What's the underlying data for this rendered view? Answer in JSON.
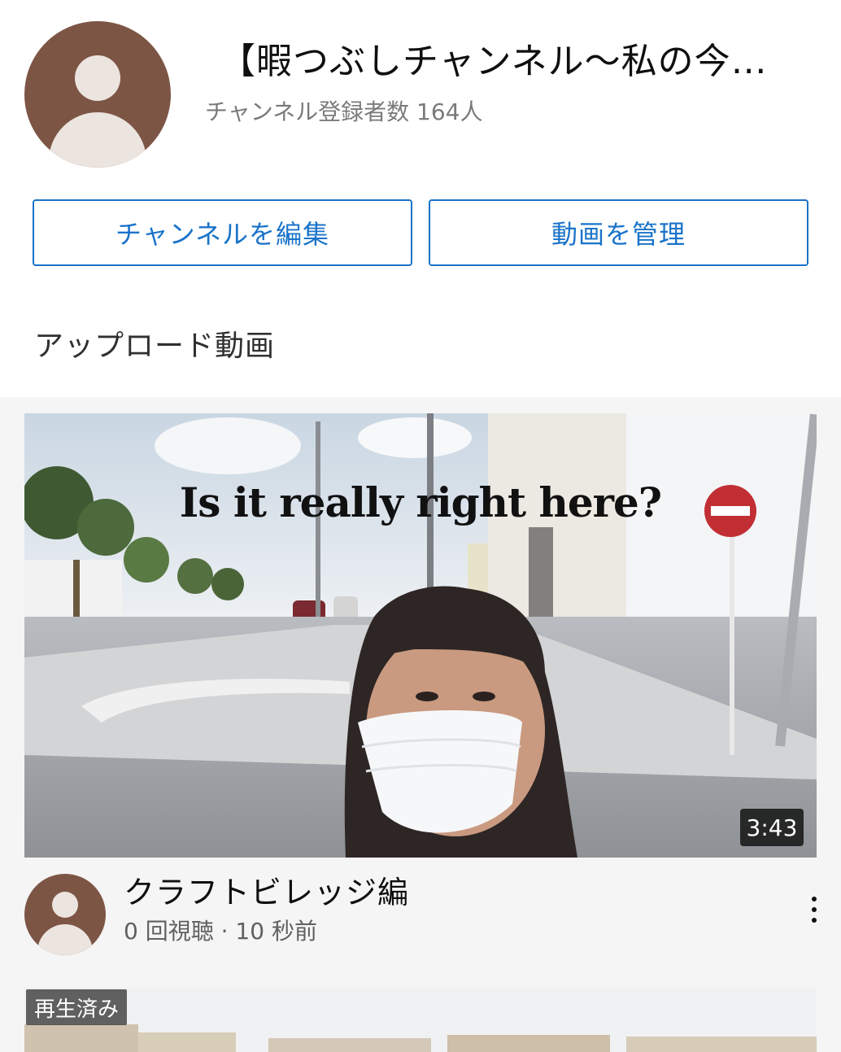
{
  "channel": {
    "title": "【暇つぶしチャンネル〜私の今…",
    "subscribers": "チャンネル登録者数 164人"
  },
  "buttons": {
    "edit_channel": "チャンネルを編集",
    "manage_videos": "動画を管理"
  },
  "section": {
    "title": "アップロード動画"
  },
  "videos": [
    {
      "thumbnail_caption": "Is it really right here?",
      "duration": "3:43",
      "title": "クラフトビレッジ編",
      "meta": "0 回視聴 · 10 秒前"
    },
    {
      "badge": "再生済み"
    }
  ],
  "colors": {
    "accent": "#1a73c9",
    "avatar_bg": "#7d5545"
  }
}
